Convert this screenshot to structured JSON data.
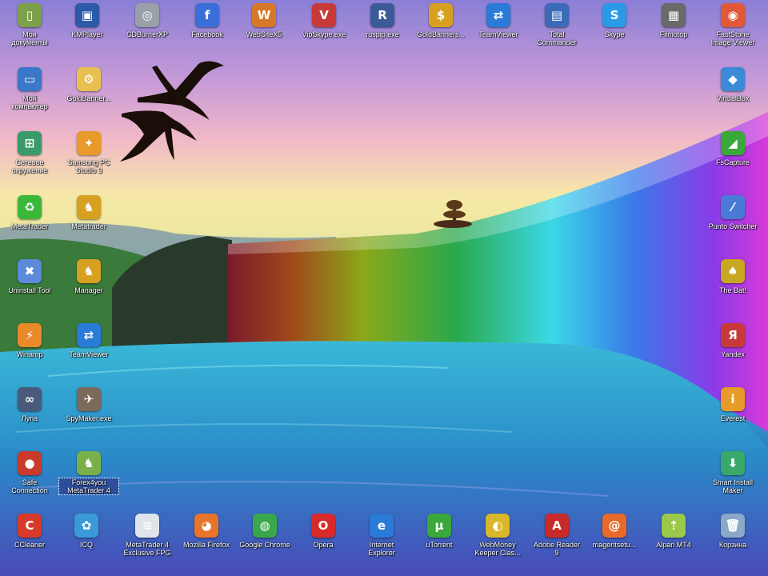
{
  "desktop": {
    "icons": [
      {
        "label": "Мои\nдокументы",
        "icon": "my-documents-icon",
        "color": "#7da04a",
        "glyph": "▯"
      },
      {
        "label": "KMPlayer",
        "icon": "kmplayer-icon",
        "color": "#2a5aa8",
        "glyph": "▣"
      },
      {
        "label": "CDBurnerXP",
        "icon": "cd-burner-icon",
        "color": "#9aa0a8",
        "glyph": "◎"
      },
      {
        "label": "Facebook",
        "icon": "facebook-icon",
        "color": "#3b6fd8",
        "glyph": "f"
      },
      {
        "label": "WebSiteX5",
        "icon": "website-builder-icon",
        "color": "#d8782a",
        "glyph": "W"
      },
      {
        "label": "VipSkype.exe",
        "icon": "vip-icon",
        "color": "#c83a3a",
        "glyph": "V"
      },
      {
        "label": "ruspip.exe",
        "icon": "ruspip-icon",
        "color": "#3a5a9a",
        "glyph": "R"
      },
      {
        "label": "GoldBanners...",
        "icon": "gold-coin-icon",
        "color": "#d8a020",
        "glyph": "$"
      },
      {
        "label": "TeamViewer",
        "icon": "teamviewer-icon",
        "color": "#2a7ad8",
        "glyph": "⇄"
      },
      {
        "label": "Total\nCommander",
        "icon": "floppy-disk-icon",
        "color": "#3a6ab8",
        "glyph": "▤"
      },
      {
        "label": "Skype",
        "icon": "skype-icon",
        "color": "#2a9ae8",
        "glyph": "S"
      },
      {
        "label": "Filmotop",
        "icon": "film-icon",
        "color": "#6a6a6a",
        "glyph": "▦"
      },
      {
        "label": "FastStone\nImage Viewer",
        "icon": "faststone-eye-icon",
        "color": "#e05a3a",
        "glyph": "◉"
      },
      {
        "label": "Мой\nкомпьютер",
        "icon": "my-computer-icon",
        "color": "#3a78c8",
        "glyph": "▭"
      },
      {
        "label": "GoldBanner...",
        "icon": "document-gear-icon",
        "color": "#e8c050",
        "glyph": "⚙"
      },
      {
        "label": "VirtualBox",
        "icon": "virtualbox-icon",
        "color": "#3a8ad8",
        "glyph": "◆"
      },
      {
        "label": "Сетевое\nокружение",
        "icon": "network-places-icon",
        "color": "#3a9a6a",
        "glyph": "⊞"
      },
      {
        "label": "Samsung PC\nStudio 3",
        "icon": "samsung-studio-icon",
        "color": "#e89a2a",
        "glyph": "✦"
      },
      {
        "label": "FsCapture",
        "icon": "fscapture-icon",
        "color": "#3aa83a",
        "glyph": "◢"
      },
      {
        "label": "MetaTrader",
        "icon": "recycle-bin-green-icon",
        "color": "#3ab83a",
        "glyph": "♻"
      },
      {
        "label": "Metatrader",
        "icon": "metatrader-bull-icon",
        "color": "#d8a020",
        "glyph": "♞"
      },
      {
        "label": "Punto Switcher",
        "icon": "punto-switcher-icon",
        "color": "#4a7ad8",
        "glyph": "⁄"
      },
      {
        "label": "Uninstall Tool",
        "icon": "uninstall-tool-icon",
        "color": "#5a8ad8",
        "glyph": "✖"
      },
      {
        "label": "Manager",
        "icon": "manager-bull-icon",
        "color": "#d8a020",
        "glyph": "♞"
      },
      {
        "label": "The Bat!",
        "icon": "the-bat-icon",
        "color": "#c8a820",
        "glyph": "♠"
      },
      {
        "label": "Winamp",
        "icon": "winamp-icon",
        "color": "#e88a2a",
        "glyph": "⚡"
      },
      {
        "label": "TeamViewer",
        "icon": "teamviewer-small-icon",
        "color": "#2a7ad8",
        "glyph": "⇄"
      },
      {
        "label": "Yandex",
        "icon": "yandex-icon",
        "color": "#c83a3a",
        "glyph": "Я"
      },
      {
        "label": "Лупа",
        "icon": "binoculars-icon",
        "color": "#4a5a7a",
        "glyph": "∞"
      },
      {
        "label": "SpyMaker.exe",
        "icon": "spymaker-icon",
        "color": "#7a6a5a",
        "glyph": "✈"
      },
      {
        "label": "Everest",
        "icon": "everest-info-icon",
        "color": "#e89a2a",
        "glyph": "i"
      },
      {
        "label": "Safe\nConnection",
        "icon": "safe-connection-icon",
        "color": "#c83a2a",
        "glyph": "●"
      },
      {
        "label": "Forex4you\nMetaTrader 4",
        "icon": "forex4you-metatrader-icon",
        "color": "#7ab04a",
        "glyph": "♞"
      },
      {
        "label": "Smart Install\nMaker",
        "icon": "smart-install-maker-icon",
        "color": "#3aa86a",
        "glyph": "⬇"
      },
      {
        "label": "CCleaner",
        "icon": "ccleaner-icon",
        "color": "#d83a2a",
        "glyph": "C"
      },
      {
        "label": "ICQ",
        "icon": "icq-flower-icon",
        "color": "#3a9ad8",
        "glyph": "✿"
      },
      {
        "label": "MetaTrader 4\nExclusive FPG",
        "icon": "metatrader-exclusive-icon",
        "color": "#dfe4ea",
        "glyph": "≋"
      },
      {
        "label": "Mozilla Firefox",
        "icon": "firefox-icon",
        "color": "#e8742a",
        "glyph": "◕"
      },
      {
        "label": "Google Chrome",
        "icon": "chrome-icon",
        "color": "#3aa84a",
        "glyph": "◍"
      },
      {
        "label": "Opera",
        "icon": "opera-icon",
        "color": "#d82a2a",
        "glyph": "O"
      },
      {
        "label": "Internet\nExplorer",
        "icon": "internet-explorer-icon",
        "color": "#2a7ad8",
        "glyph": "e"
      },
      {
        "label": "uTorrent",
        "icon": "utorrent-icon",
        "color": "#3aa83a",
        "glyph": "µ"
      },
      {
        "label": "WebMoney\nKeeper Clas...",
        "icon": "webmoney-icon",
        "color": "#d8b82a",
        "glyph": "◐"
      },
      {
        "label": "Adobe Reader\n9",
        "icon": "adobe-reader-icon",
        "color": "#c82a2a",
        "glyph": "A"
      },
      {
        "label": "magentsetu...",
        "icon": "mail-agent-icon",
        "color": "#e86a2a",
        "glyph": "@"
      },
      {
        "label": "Alpari MT4",
        "icon": "alpari-mt4-icon",
        "color": "#9ac84a",
        "glyph": "⇡"
      },
      {
        "label": "Корзина",
        "icon": "recycle-bin-icon",
        "color": "#8aa8c8",
        "glyph": "🗑"
      }
    ]
  }
}
